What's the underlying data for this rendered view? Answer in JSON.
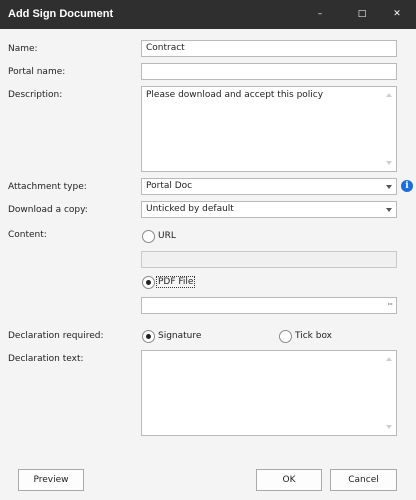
{
  "window": {
    "title": "Add Sign Document",
    "controls": {
      "minimize": "–",
      "maximize": "□",
      "close": "✕"
    }
  },
  "fields": {
    "name_label": "Name:",
    "name_value": "Contract",
    "portal_name_label": "Portal name:",
    "portal_name_value": "",
    "description_label": "Description:",
    "description_value": "Please download and accept this policy",
    "attachment_type_label": "Attachment type:",
    "attachment_type_value": "Portal Doc",
    "download_copy_label": "Download a copy:",
    "download_copy_value": "Unticked by default",
    "content_label": "Content:",
    "content_url_option": "URL",
    "content_url_value": "",
    "content_pdf_option": "PDF File",
    "content_pdf_value": "",
    "browse_label": "···",
    "declaration_required_label": "Declaration required:",
    "declaration_signature_option": "Signature",
    "declaration_tickbox_option": "Tick box",
    "declaration_text_label": "Declaration text:",
    "declaration_text_value": ""
  },
  "state": {
    "content_selected": "PDF File",
    "declaration_selected": "Signature"
  },
  "icons": {
    "info": "i"
  },
  "buttons": {
    "preview": "Preview",
    "ok": "OK",
    "cancel": "Cancel"
  },
  "colors": {
    "titlebar": "#2f2f2f",
    "info_icon": "#1e6ed8"
  }
}
